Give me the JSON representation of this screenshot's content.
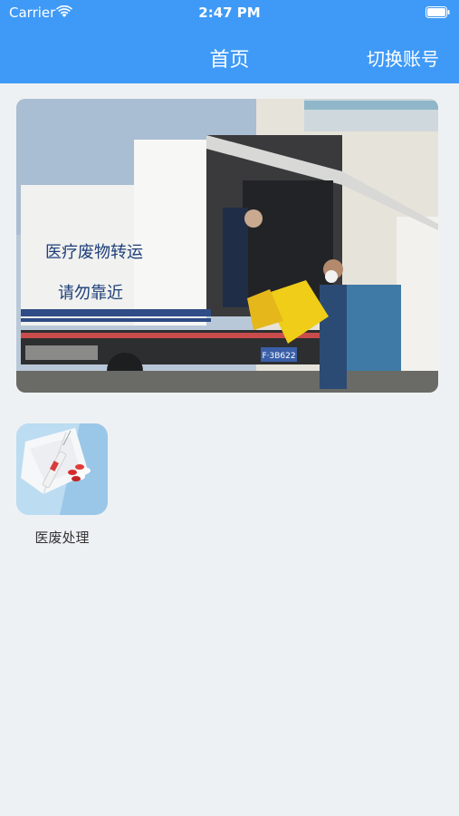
{
  "status_bar": {
    "carrier": "Carrier",
    "time": "2:47 PM"
  },
  "nav": {
    "title": "首页",
    "right_action": "切换账号"
  },
  "banner": {
    "truck_text_line1": "医疗废物转运",
    "truck_text_line2": "请勿靠近",
    "plate_text": "F·3B622"
  },
  "grid": [
    {
      "label": "医废处理",
      "icon": "medical-waste-icon"
    }
  ],
  "colors": {
    "nav_blue": "#3f9af7",
    "page_bg": "#eef1f3"
  }
}
